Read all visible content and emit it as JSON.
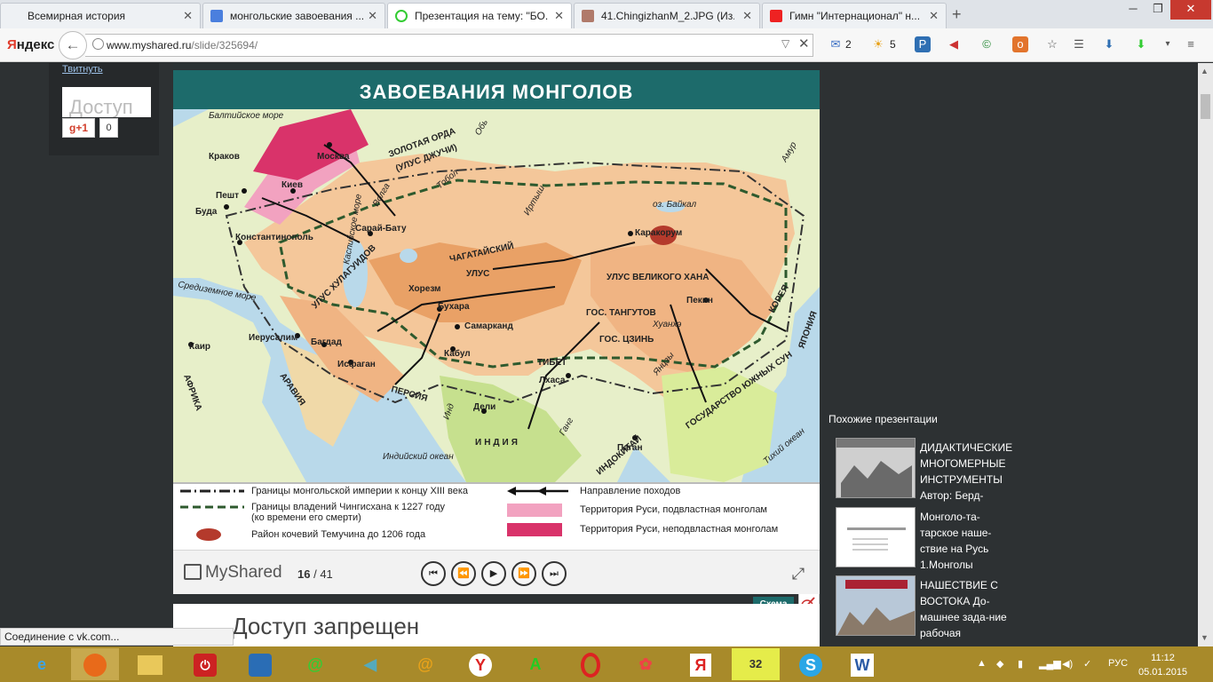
{
  "browser": {
    "tabs": [
      {
        "label": "Всемирная история",
        "active": false
      },
      {
        "label": "монгольские завоевания ...",
        "active": false
      },
      {
        "label": "Презентация на тему: \"БО...",
        "active": true
      },
      {
        "label": "41.ChingizhanM_2.JPG (Из...",
        "active": false
      },
      {
        "label": "Гимн \"Интернационал\" н...",
        "active": false
      }
    ],
    "new_tab": "+",
    "window_controls": {
      "minimize": "─",
      "maximize": "❐",
      "close": "✕"
    },
    "yandex_logo_first": "Я",
    "yandex_logo_rest": "ндекс",
    "url_host": "www.myshared.ru",
    "url_path": "/slide/325694/",
    "url_clear": "✕",
    "mail_count": "2",
    "weather_count": "5"
  },
  "left_widget": {
    "tweet_link": "Твитнуть",
    "card_text": "Доступ",
    "gplus_label": "g+1",
    "gplus_count": "0"
  },
  "slide": {
    "title": "ЗАВОЕВАНИЯ  МОНГОЛОВ",
    "map_labels": {
      "baltic": "Балтийское море",
      "moscow": "Москва",
      "krakow": "Краков",
      "kiev": "Киев",
      "pest": "Пешт",
      "buda": "Буда",
      "golden_horde": "ЗОЛОТАЯ ОРДА",
      "ulus_juchi": "(УЛУС ДЖУЧИ)",
      "volga": "Волга",
      "tobol": "Тобол",
      "ob": "Обь",
      "irtysh": "Иртыш",
      "baikal": "оз. Байкал",
      "amur": "Амур",
      "constantinople": "Константинополь",
      "sarai": "Сарай-Бату",
      "karakorum": "Каракорум",
      "chagatai": "ЧАГАТАЙСКИЙ",
      "ulus": "УЛУС",
      "great_khan": "УЛУС ВЕЛИКОГО ХАНА",
      "caspian": "Каспийское море",
      "mediterranean": "Средиземное море",
      "khorezm": "Хорезм",
      "bukhara": "Бухара",
      "samarkand": "Самарканд",
      "tanguts": "ГОС. ТАНГУТОВ",
      "jin": "ГОС. ЦЗИНЬ",
      "huanghe": "Хуанхэ",
      "beijing": "Пекин",
      "korea": "КОРЕЯ",
      "japan": "ЯПОНИЯ",
      "cairo": "Каир",
      "jerusalem": "Иерусалим",
      "baghdad": "Багдад",
      "ulus_hulagu": "УЛУС ХУЛАГУИДОВ",
      "isfahan": "Исфаган",
      "kabul": "Кабул",
      "tibet": "ТИБЕТ",
      "lhasa": "Лхаса",
      "yangtze": "Янцзы",
      "southern_song": "ГОСУДАРСТВО ЮЖНЫХ СУН",
      "africa": "АФРИКА",
      "arabia": "АРАВИЯ",
      "persia": "ПЕРСИЯ",
      "indus": "Инд",
      "delhi": "Дели",
      "india": "ИНДИЯ",
      "ganges": "Ганг",
      "pagan": "Паган",
      "indochina": "ИНДОКИТАЙ",
      "indian_ocean": "Индийский океан",
      "pacific": "Тихий океан"
    },
    "legend": {
      "border_empire": "Границы монгольской империи к концу XIII века",
      "border_genghis": "Границы владений Чингисхана к 1227 году",
      "border_genghis_sub": "(ко времени его смерти)",
      "nomad_area": "Район кочевий Темучина до 1206 года",
      "campaign": "Направление походов",
      "rus_subject": "Территория Руси, подвластная монголам",
      "rus_free": "Территория Руси, неподвластная монголам"
    },
    "schema_button": "Схема"
  },
  "player": {
    "brand": "MyShared",
    "current": "16",
    "separator": " / ",
    "total": "41",
    "buttons": {
      "first": "⏮",
      "prev": "⏪",
      "play": "▶",
      "next": "⏩",
      "last": "⏭"
    }
  },
  "lower_card_text": "Доступ запрещен",
  "status_bar": "Соединение с vk.com...",
  "similar": {
    "heading": "Похожие презентации",
    "items": [
      {
        "text": "ДИДАКТИЧЕСКИЕ МНОГОМЕРНЫЕ ИНСТРУМЕНТЫ Автор: Берд-"
      },
      {
        "text": "Монголо-та-тарское наше-ствие на Русь 1.Монголы"
      },
      {
        "text": "НАШЕСТВИЕ С ВОСТОКА До-машнее зада-ние рабочая"
      }
    ]
  },
  "taskbar": {
    "lang": "РУС",
    "time": "11:12",
    "date": "05.01.2015",
    "apps": [
      "IE",
      "Firefox",
      "Explorer",
      "Power",
      "Registry",
      "Mail.ru Agent",
      "Volume",
      "Mail",
      "Yandex Browser",
      "Amigo",
      "Opera",
      "Flower",
      "Yandex",
      "Tabs",
      "Skype",
      "Word"
    ]
  },
  "colors": {
    "accent_teal": "#1d6b6b",
    "rus_subject": "#f2a2c0",
    "rus_free": "#d9336a",
    "mongol_orange": "#e9a166",
    "sea": "#b9d9ea"
  }
}
